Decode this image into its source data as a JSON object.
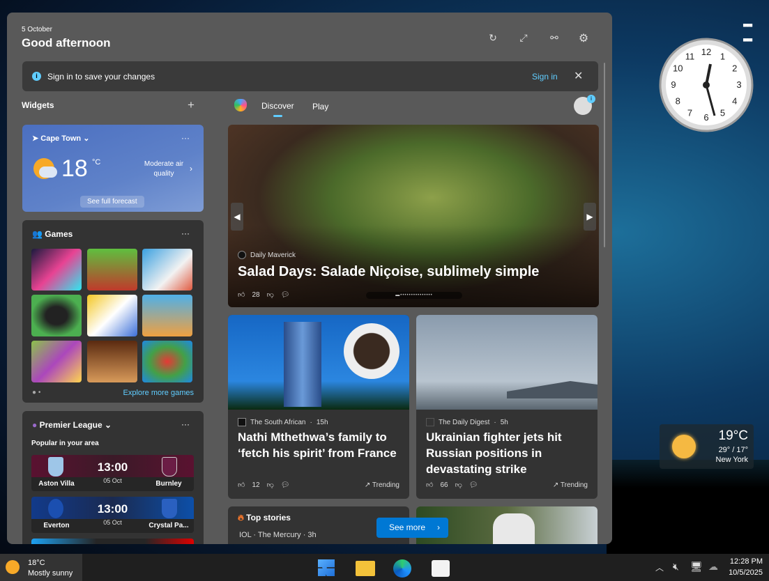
{
  "header": {
    "date": "5 October",
    "greeting": "Good afternoon",
    "icons": [
      "refresh-icon",
      "expand-icon",
      "link-icon",
      "gear-icon"
    ]
  },
  "signin_banner": {
    "message": "Sign in to save your changes",
    "action": "Sign in"
  },
  "widgets": {
    "title": "Widgets",
    "weather": {
      "location": "Cape Town",
      "temp": "18",
      "unit": "°C",
      "air": "Moderate air quality",
      "forecast_button": "See full forecast"
    },
    "games": {
      "title": "Games",
      "explore": "Explore more games"
    },
    "league": {
      "title": "Premier League",
      "subtitle": "Popular in your area",
      "matches": [
        {
          "home": "Aston Villa",
          "away": "Burnley",
          "time": "13:00",
          "date": "05 Oct"
        },
        {
          "home": "Everton",
          "away": "Crystal Pa...",
          "time": "13:00",
          "date": "05 Oct"
        }
      ]
    }
  },
  "feed": {
    "tabs": [
      {
        "label": "Discover",
        "active": true
      },
      {
        "label": "Play",
        "active": false
      }
    ],
    "hero": {
      "source": "Daily Maverick",
      "title": "Salad Days: Salade Niçoise, sublimely simple",
      "likes": "28"
    },
    "articles": [
      {
        "source": "The South African",
        "age": "15h",
        "title": "Nathi Mthethwa’s family to ‘fetch his spirit’ from France",
        "likes": "12",
        "trending": "Trending"
      },
      {
        "source": "The Daily Digest",
        "age": "5h",
        "title": "Ukrainian fighter jets hit Russian positions in devastating strike",
        "likes": "66",
        "trending": "Trending"
      }
    ],
    "top_stories": {
      "title": "Top stories",
      "first_source": "IOL · The Mercury · 3h"
    },
    "see_more": "See more"
  },
  "desktop_weather": {
    "temp": "19°C",
    "range": "29° / 17°",
    "city": "New York"
  },
  "clock": {
    "numbers": [
      "12",
      "1",
      "2",
      "3",
      "4",
      "5",
      "6",
      "7",
      "8",
      "9",
      "10",
      "11"
    ]
  },
  "taskbar": {
    "weather_temp": "18°C",
    "weather_desc": "Mostly sunny",
    "time": "12:28 PM",
    "date": "10/5/2025"
  },
  "colors": {
    "accent": "#0078d4",
    "link": "#60cdff",
    "panel": "#595959",
    "card": "#333333"
  }
}
